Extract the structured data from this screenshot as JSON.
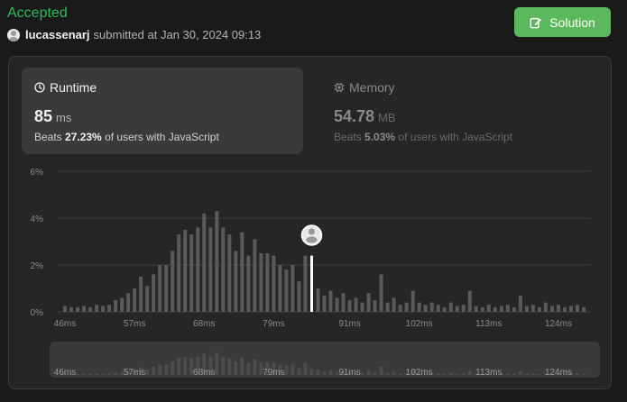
{
  "submission": {
    "status": "Accepted",
    "username": "lucassenarj",
    "submitted_text": "submitted at Jan 30, 2024 09:13"
  },
  "header": {
    "solution_label": "Solution"
  },
  "runtime": {
    "label": "Runtime",
    "value": "85",
    "unit": "ms",
    "beats_prefix": "Beats",
    "beats_percent": "27.23%",
    "beats_suffix": "of users with JavaScript"
  },
  "memory": {
    "label": "Memory",
    "value": "54.78",
    "unit": "MB",
    "beats_prefix": "Beats",
    "beats_percent": "5.03%",
    "beats_suffix": "of users with JavaScript"
  },
  "colors": {
    "accepted": "#2cbb5d",
    "button": "#5cb85c",
    "bar": "#5a5a5a",
    "highlight": "#ffffff"
  },
  "chart_data": {
    "type": "bar",
    "y_ticks": [
      "6%",
      "4%",
      "2%",
      "0%"
    ],
    "ylim": [
      0,
      6
    ],
    "x_tick_labels": [
      "46ms",
      "57ms",
      "68ms",
      "79ms",
      "91ms",
      "102ms",
      "113ms",
      "124ms"
    ],
    "x_tick_values": [
      46,
      57,
      68,
      79,
      91,
      102,
      113,
      124
    ],
    "x": [
      46,
      47,
      48,
      49,
      50,
      51,
      52,
      53,
      54,
      55,
      56,
      57,
      58,
      59,
      60,
      61,
      62,
      63,
      64,
      65,
      66,
      67,
      68,
      69,
      70,
      71,
      72,
      73,
      74,
      75,
      76,
      77,
      78,
      79,
      80,
      81,
      82,
      83,
      84,
      85,
      86,
      87,
      88,
      89,
      90,
      91,
      92,
      93,
      94,
      95,
      96,
      97,
      98,
      99,
      100,
      101,
      102,
      103,
      104,
      105,
      106,
      107,
      108,
      109,
      110,
      111,
      112,
      113,
      114,
      115,
      116,
      117,
      118,
      119,
      120,
      121,
      122,
      123,
      124,
      125,
      126,
      127,
      128
    ],
    "values": [
      0.25,
      0.2,
      0.2,
      0.25,
      0.2,
      0.3,
      0.25,
      0.3,
      0.5,
      0.6,
      0.8,
      1.0,
      1.5,
      1.1,
      1.6,
      2.0,
      2.0,
      2.6,
      3.3,
      3.5,
      3.3,
      3.6,
      4.2,
      3.6,
      4.3,
      3.6,
      3.3,
      2.6,
      3.4,
      2.4,
      3.1,
      2.5,
      2.5,
      2.4,
      2.0,
      1.8,
      2.0,
      1.3,
      2.4,
      1.2,
      1.0,
      0.7,
      0.9,
      0.6,
      0.8,
      0.5,
      0.6,
      0.4,
      0.8,
      0.5,
      1.6,
      0.4,
      0.6,
      0.3,
      0.4,
      0.9,
      0.4,
      0.3,
      0.4,
      0.3,
      0.2,
      0.4,
      0.25,
      0.3,
      0.9,
      0.25,
      0.2,
      0.3,
      0.2,
      0.25,
      0.3,
      0.2,
      0.7,
      0.25,
      0.3,
      0.2,
      0.4,
      0.25,
      0.3,
      0.2,
      0.25,
      0.3,
      0.2
    ],
    "highlight_x": 85,
    "highlight_value": 2.4,
    "grid": true
  }
}
